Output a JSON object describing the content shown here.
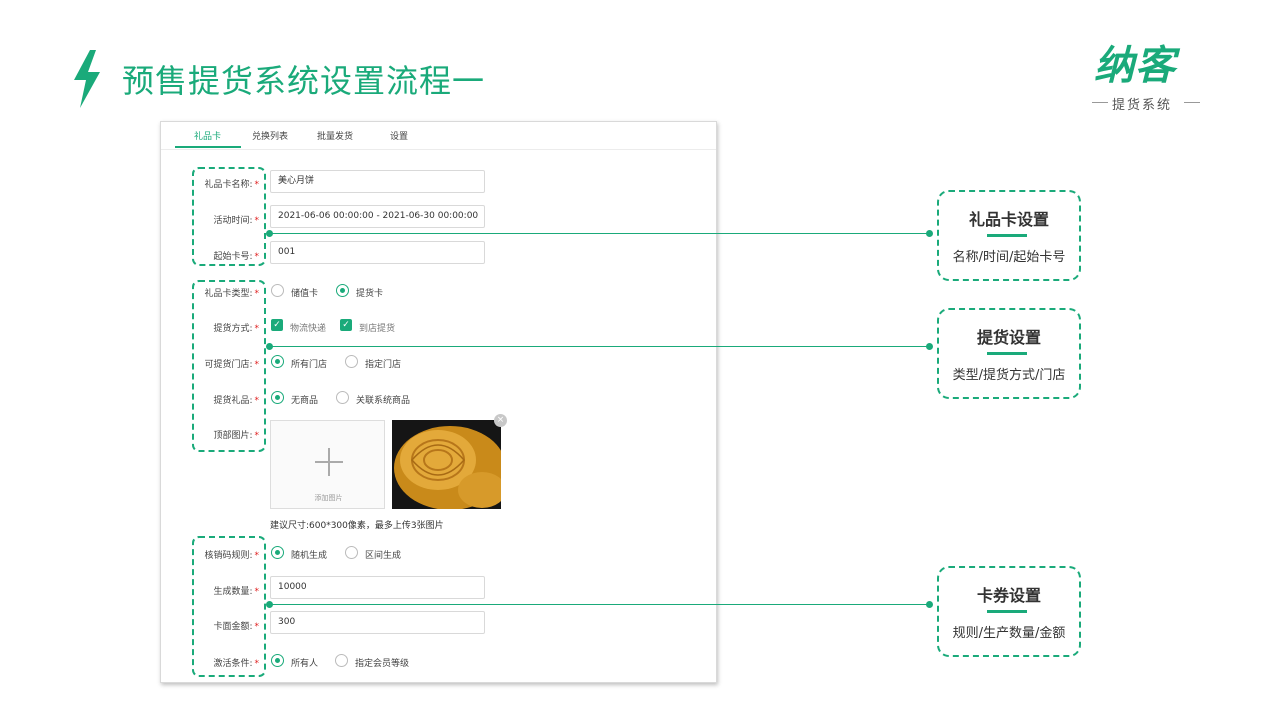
{
  "page_title": "预售提货系统设置流程一",
  "logo": {
    "main": "纳客",
    "sub": "提货系统"
  },
  "tabs": [
    {
      "label": "礼品卡",
      "active": true
    },
    {
      "label": "兑换列表",
      "active": false
    },
    {
      "label": "批量发货",
      "active": false
    },
    {
      "label": "设置",
      "active": false
    }
  ],
  "form": {
    "card_name": {
      "label": "礼品卡名称:",
      "value": "美心月饼"
    },
    "activity_time": {
      "label": "活动时间:",
      "value": "2021-06-06 00:00:00 - 2021-06-30 00:00:00"
    },
    "start_no": {
      "label": "起始卡号:",
      "value": "001"
    },
    "card_type": {
      "label": "礼品卡类型:",
      "options": [
        "储值卡",
        "提货卡"
      ],
      "selected": "提货卡"
    },
    "pickup_method": {
      "label": "提货方式:",
      "options": [
        "物流快递",
        "到店提货"
      ],
      "checked": [
        "物流快递",
        "到店提货"
      ]
    },
    "pickup_store": {
      "label": "可提货门店:",
      "options": [
        "所有门店",
        "指定门店"
      ],
      "selected": "所有门店"
    },
    "pickup_gift": {
      "label": "提货礼品:",
      "options": [
        "无商品",
        "关联系统商品"
      ],
      "selected": "无商品"
    },
    "top_image": {
      "label": "顶部图片:",
      "upload_text": "添加图片",
      "hint": "建议尺寸:600*300像素，最多上传3张图片"
    },
    "code_rule": {
      "label": "核销码规则:",
      "options": [
        "随机生成",
        "区间生成"
      ],
      "selected": "随机生成"
    },
    "gen_count": {
      "label": "生成数量:",
      "value": "10000"
    },
    "face_value": {
      "label": "卡面金额:",
      "value": "300"
    },
    "activate_cond": {
      "label": "激活条件:",
      "options": [
        "所有人",
        "指定会员等级"
      ],
      "selected": "所有人"
    },
    "required_mark": "*"
  },
  "callouts": [
    {
      "title": "礼品卡设置",
      "desc": "名称/时间/起始卡号"
    },
    {
      "title": "提货设置",
      "desc": "类型/提货方式/门店"
    },
    {
      "title": "卡券设置",
      "desc": "规则/生产数量/金额"
    }
  ],
  "colors": {
    "accent": "#1aaa7a",
    "required": "#e02020"
  }
}
